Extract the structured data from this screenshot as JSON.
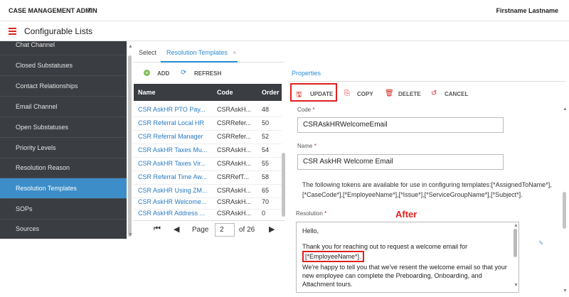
{
  "header": {
    "app_title": "CASE MANAGEMENT ADMIN",
    "user_name": "Firstname Lastname",
    "page_title": "Configurable Lists"
  },
  "sidebar": {
    "items": [
      {
        "label": "Chat Channel"
      },
      {
        "label": "Closed Substatuses"
      },
      {
        "label": "Contact Relationships"
      },
      {
        "label": "Email Channel"
      },
      {
        "label": "Open Substatuses"
      },
      {
        "label": "Priority Levels"
      },
      {
        "label": "Resolution Reason"
      },
      {
        "label": "Resolution Templates",
        "active": true
      },
      {
        "label": "SOPs"
      },
      {
        "label": "Sources"
      }
    ]
  },
  "tabs": {
    "select": "Select",
    "resolution_templates": "Resolution Templates",
    "close": "×"
  },
  "list_toolbar": {
    "add": "ADD",
    "refresh": "REFRESH"
  },
  "grid": {
    "columns": [
      "Name",
      "Code",
      "Order"
    ],
    "rows": [
      {
        "name": "CSR AskHR PTO Pay...",
        "code": "CSRAskH...",
        "order": "48"
      },
      {
        "name": "CSR Referral Local HR",
        "code": "CSRRefer...",
        "order": "50"
      },
      {
        "name": "CSR Referral Manager",
        "code": "CSRRefer...",
        "order": "52"
      },
      {
        "name": "CSR AskHR Taxes Mu...",
        "code": "CSRAskH...",
        "order": "54"
      },
      {
        "name": "CSR AskHR Taxes Vir...",
        "code": "CSRAskH...",
        "order": "55"
      },
      {
        "name": "CSR Referral Time Aw...",
        "code": "CSRRefT...",
        "order": "58"
      },
      {
        "name": "CSR AskHR Using ZM...",
        "code": "CSRAskH...",
        "order": "65"
      },
      {
        "name": "CSR AskHR Welcome...",
        "code": "CSRAskH...",
        "order": "70"
      },
      {
        "name": "CSR AskHR Address ...",
        "code": "CSRAskH...",
        "order": "0"
      }
    ]
  },
  "pager": {
    "page_label": "Page",
    "current_page": "2",
    "of_label": "of 26"
  },
  "properties": {
    "tab_label": "Properties",
    "actions": {
      "update": "UPDATE",
      "copy": "COPY",
      "delete": "DELETE",
      "cancel": "CANCEL"
    },
    "code_label": "Code",
    "code_value": "CSRAskHRWelcomeEmail",
    "name_label": "Name",
    "name_value": "CSR AskHR Welcome Email",
    "tokens_text": "The following tokens are available for use in configuring templates:[*AssignedToName*],[*CaseCode*],[*EmployeeName*],[*Issue*],[*ServiceGroupName*],[*Subject*].",
    "resolution_label": "Resolution",
    "after_label": "After",
    "resolution_greeting": "Hello,",
    "resolution_line1": "Thank you for reaching out to request a welcome email for",
    "resolution_token": "[*EmployeeName*].",
    "resolution_line2": "We're happy to tell you that we've resent the welcome email so that your new employee can complete the Preboarding, Onboarding, and Attachment tours."
  },
  "colors": {
    "accent": "#2a8bd0",
    "sidebar_bg": "#3a3d42",
    "sidebar_active": "#3c8dc8",
    "highlight_red": "#e02020"
  }
}
